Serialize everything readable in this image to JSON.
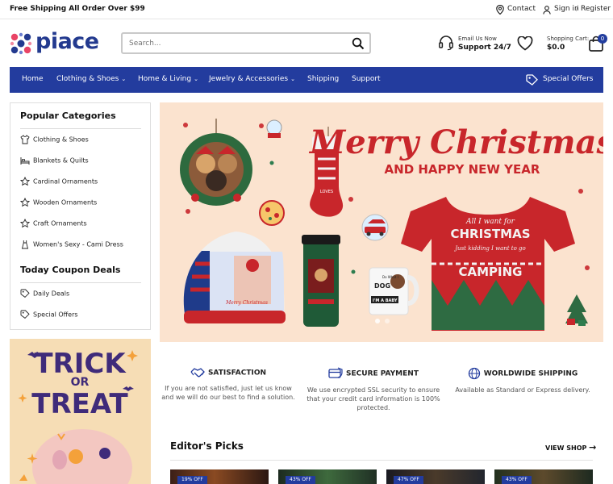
{
  "topbar": {
    "shipping_notice": "Free Shipping All Order Over $99",
    "contact": "Contact",
    "signin": "Sign in",
    "separator": "/",
    "register": "Register"
  },
  "header": {
    "logo_text": "piace",
    "search_placeholder": "Search...",
    "support_small": "Email Us Now",
    "support_big": "Support 24/7",
    "cart_small": "Shopping Cart:",
    "cart_total": "$0.0",
    "cart_count": "0"
  },
  "nav": {
    "items": [
      {
        "label": "Home"
      },
      {
        "label": "Clothing & Shoes"
      },
      {
        "label": "Home & Living"
      },
      {
        "label": "Jewelry & Accessories"
      },
      {
        "label": "Shipping"
      },
      {
        "label": "Support"
      }
    ],
    "special": "Special Offers"
  },
  "sidebar": {
    "popular_title": "Popular Categories",
    "categories": [
      {
        "label": "Clothing & Shoes",
        "icon": "shirt-icon"
      },
      {
        "label": "Blankets & Quilts",
        "icon": "bed-icon"
      },
      {
        "label": "Cardinal Ornaments",
        "icon": "star-icon"
      },
      {
        "label": "Wooden Ornaments",
        "icon": "star-icon"
      },
      {
        "label": "Craft Ornaments",
        "icon": "star-icon"
      },
      {
        "label": "Women's Sexy - Cami Dress",
        "icon": "dress-icon"
      }
    ],
    "coupon_title": "Today Coupon Deals",
    "coupons": [
      {
        "label": "Daily Deals",
        "icon": "tag-icon"
      },
      {
        "label": "Special Offers",
        "icon": "tag-icon"
      }
    ]
  },
  "promo": {
    "line1": "TRICK",
    "line2": "OR",
    "line3": "TREAT"
  },
  "hero": {
    "title": "Merry Christmas",
    "subtitle": "AND HAPPY NEW YEAR",
    "shirt_text1": "All I want for",
    "shirt_text2": "CHRISTMAS",
    "shirt_text3": "Just kidding I want to go",
    "shirt_text4": "CAMPING",
    "mug_text1": "Do What I",
    "mug_text2": "DOG",
    "mug_text3": "I'M A BABY",
    "hat_text": "Merry Christmas",
    "stocking_text": "LOVES"
  },
  "features": [
    {
      "title": "SATISFACTION",
      "desc": "If you are not satisfied, just let us know and we will do our best to find a solution."
    },
    {
      "title": "SECURE PAYMENT",
      "desc": "We use encrypted SSL security to ensure that your credit card information is 100% protected."
    },
    {
      "title": "WORLDWIDE SHIPPING",
      "desc": "Available as Standard or Express delivery."
    }
  ],
  "picks": {
    "title": "Editor's Picks",
    "view_shop": "VIEW SHOP",
    "arrow": "→",
    "cards": [
      {
        "discount": "19% OFF"
      },
      {
        "discount": "43% OFF"
      },
      {
        "discount": "47% OFF"
      },
      {
        "discount": "43% OFF"
      }
    ]
  },
  "colors": {
    "brand_blue": "#233c9e",
    "hero_bg": "#fbe3cf",
    "hero_red": "#c8262b",
    "promo_bg": "#f6ddb5"
  }
}
